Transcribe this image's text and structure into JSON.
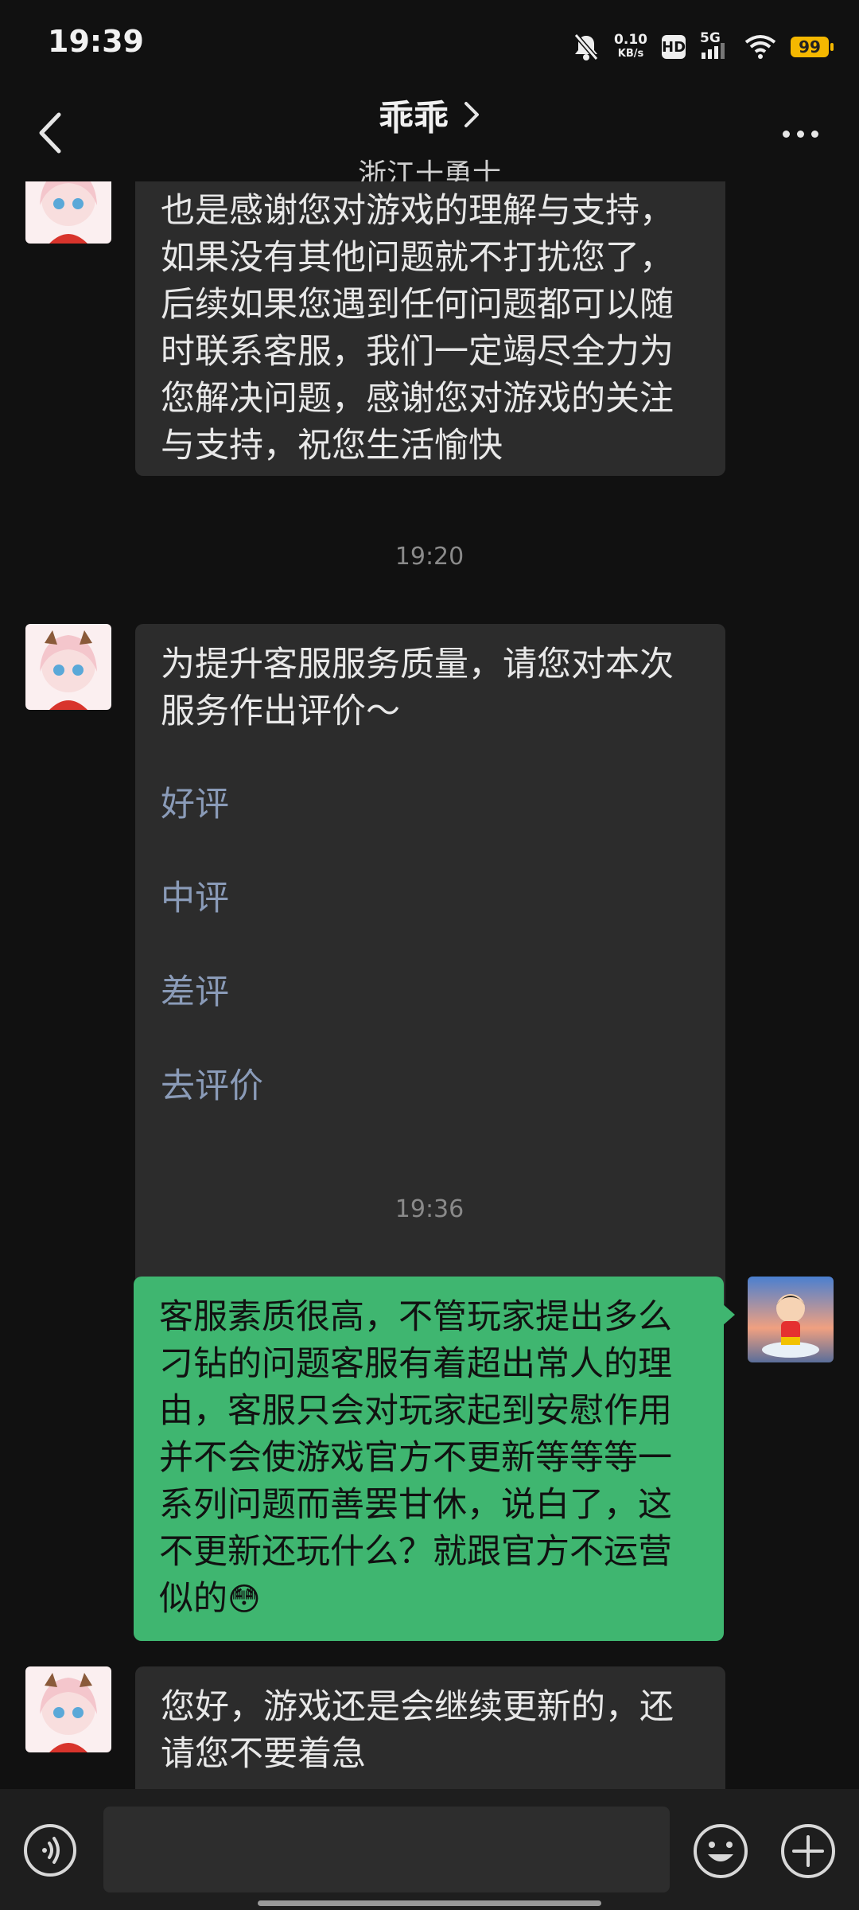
{
  "status_bar": {
    "time": "19:39",
    "net_speed_value": "0.10",
    "net_speed_unit": "KB/s",
    "hd_label": "HD",
    "network": "5G",
    "battery": "99",
    "icons": [
      "mute-bell-icon",
      "signal-icon",
      "wifi-icon",
      "battery-icon"
    ]
  },
  "header": {
    "title": "乖乖",
    "subtitle": "浙江十勇士",
    "icons": [
      "back-arrow-icon",
      "chevron-right-icon",
      "more-icon"
    ]
  },
  "messages": [
    {
      "side": "in",
      "text": "也是感谢您对游戏的理解与支持，如果没有其他问题就不打扰您了，后续如果您遇到任何问题都可以随时联系客服，我们一定竭尽全力为您解决问题，感谢您对游戏的关注与支持，祝您生活愉快"
    },
    {
      "timestamp": "19:20"
    },
    {
      "side": "in",
      "text": "为提升客服服务质量，请您对本次服务作出评价～",
      "options": [
        "好评",
        "中评",
        "差评",
        "去评价"
      ]
    },
    {
      "timestamp": "19:36"
    },
    {
      "side": "out",
      "text": "客服素质很高，不管玩家提出多么刁钻的问题客服有着超出常人的理由，客服只会对玩家起到安慰作用并不会使游戏官方不更新等等等一系列问题而善罢甘休，说白了，这不更新还玩什么？就跟官方不运营似的",
      "emoji": "😳"
    },
    {
      "side": "in",
      "text": "您好，游戏还是会继续更新的，还请您不要着急"
    }
  ],
  "input_bar": {
    "placeholder": "",
    "icons": [
      "voice-icon",
      "emoji-icon",
      "plus-icon"
    ]
  },
  "colors": {
    "background": "#111111",
    "incoming_bubble": "#2c2c2c",
    "outgoing_bubble": "#3fb670",
    "option_link": "#8a9bb8",
    "battery": "#f5b800"
  }
}
